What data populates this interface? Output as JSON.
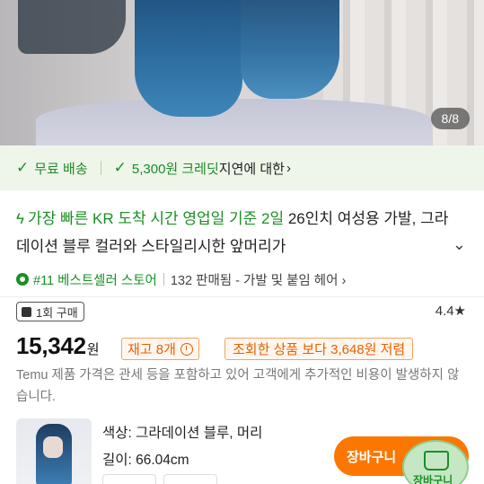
{
  "gallery": {
    "pager": "8/8"
  },
  "benefits": {
    "free_shipping": "무료 배송",
    "credit_amount": "5,300원 크레딧",
    "credit_suffix": "지연에 대한",
    "chevron": "›"
  },
  "product": {
    "promo": "가장 빠른 KR 도착 시간 영업일 기준 2일",
    "title": "26인치 여성용 가발, 그라데이션 블루 컬러와 스타일리시한 앞머리가",
    "best_seller": "#11 베스트셀러 스토어",
    "sold": "132 판매됨",
    "category": "- 가발 및 붙임 헤어 ›",
    "purchase_badge": "1회 구매",
    "rating": "4.4★"
  },
  "price": {
    "amount": "15,342",
    "currency": "원",
    "stock": "재고 8개",
    "compare": "조회한 상품 보다 3,648원 저렴",
    "note": "Temu 제품 가격은 관세 등을 포함하고 있어 고객에게 추가적인 비용이 발생하지 않습니다."
  },
  "variant": {
    "color": "색상: 그라데이션 블루, 머리",
    "length": "길이: 66.04cm",
    "add_to_cart": "장바구니",
    "cart_label": "장바구니"
  },
  "colors": {
    "green": "#1a8f25",
    "orange": "#fb7701"
  }
}
